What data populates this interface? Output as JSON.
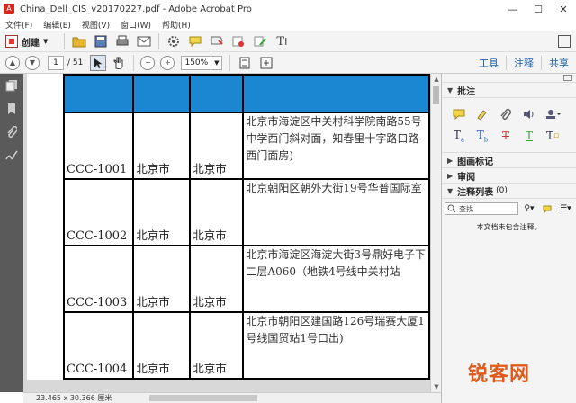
{
  "window": {
    "title": "China_Dell_CIS_v20170227.pdf - Adobe Acrobat Pro",
    "controls": [
      "—",
      "☐",
      "✕"
    ]
  },
  "menu": [
    "文件(F)",
    "编辑(E)",
    "视图(V)",
    "窗口(W)",
    "帮助(H)"
  ],
  "toolbar": {
    "create_label": "创建",
    "icons": [
      "open-folder-icon",
      "save-icon",
      "print-icon",
      "email-icon",
      "gear-icon",
      "comment-icon",
      "stamp-icon",
      "sign-icon",
      "edit-icon",
      "text-icon"
    ]
  },
  "navbar": {
    "current_page": "1",
    "total_pages": "/ 51",
    "zoom": "150%"
  },
  "right_tabs": [
    "工具",
    "注释",
    "共享"
  ],
  "table": {
    "rows": [
      {
        "code": "CCC-1001",
        "city": "北京市",
        "city2": "北京市",
        "address": "北京市海淀区中关村科学院南路55号中学西门斜对面，知春里十字路口路西门面房)"
      },
      {
        "code": "CCC-1002",
        "city": "北京市",
        "city2": "北京市",
        "address": "北京朝阳区朝外大街19号华普国际室"
      },
      {
        "code": "CCC-1003",
        "city": "北京市",
        "city2": "北京市",
        "address": "北京市海淀区海淀大街3号鼎好电子下二层A060（地铁4号线中关村站"
      },
      {
        "code": "CCC-1004",
        "city": "北京市",
        "city2": "北京市",
        "address": "北京市朝阳区建国路126号瑞赛大厦1号线国贸站1号口出)"
      }
    ]
  },
  "status": {
    "dimensions": "23.465 x 30.366 厘米"
  },
  "panel": {
    "annotations_title": "批注",
    "drawing_title": "图画标记",
    "review_title": "审阅",
    "list_title": "注释列表",
    "list_count": "(0)",
    "search_placeholder": "查找",
    "empty_message": "本文档未包含注释。",
    "tool_icons": [
      "sticky-note-icon",
      "highlight-icon",
      "attach-icon",
      "audio-icon",
      "stamp-icon",
      "insert-text-icon",
      "replace-text-icon",
      "strikethrough-icon",
      "underline-icon",
      "add-text-icon"
    ]
  },
  "watermark": "锐客网",
  "colors": {
    "header_blue": "#1b86d2",
    "link_blue": "#1a5fa8",
    "watermark_orange": "#e05a1a"
  }
}
